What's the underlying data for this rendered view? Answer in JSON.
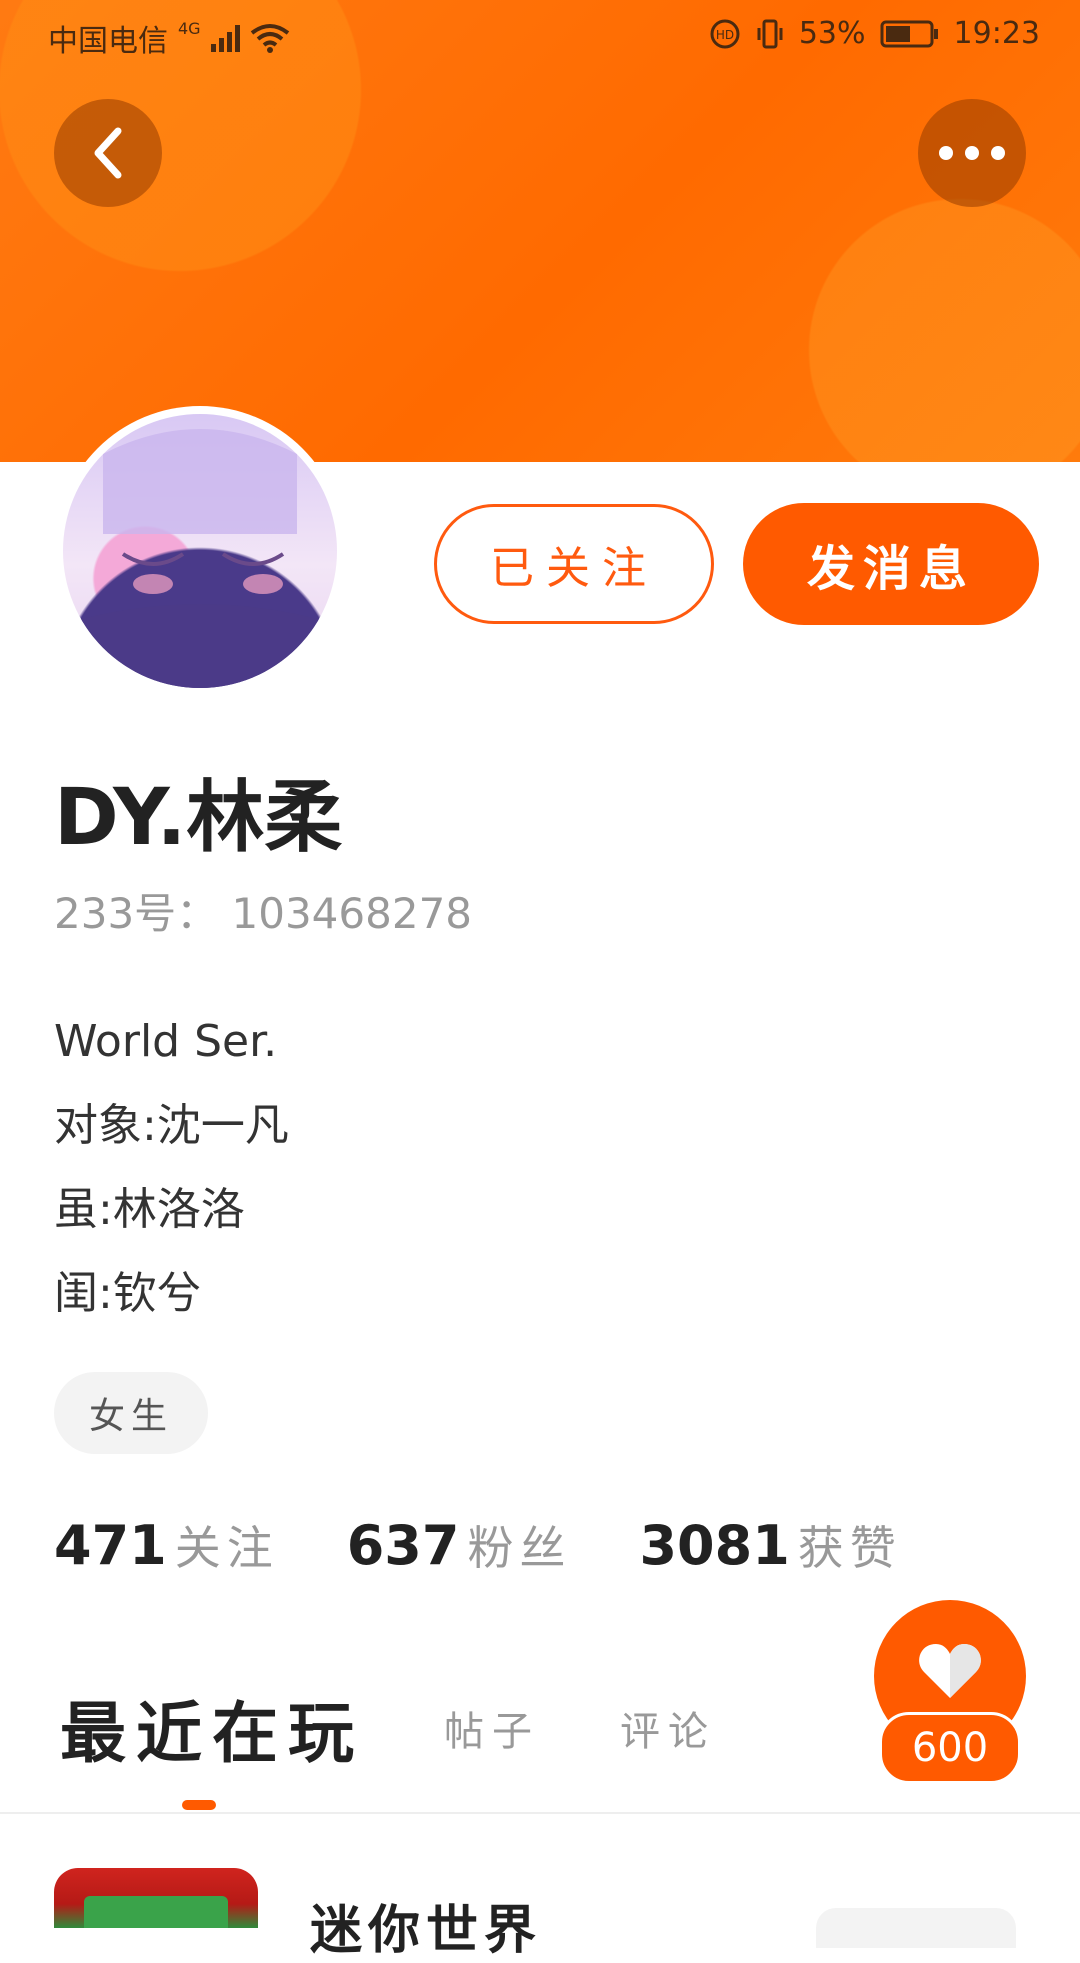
{
  "status_bar": {
    "carrier": "中国电信",
    "network": "4G",
    "battery_percent": "53%",
    "time": "19:23"
  },
  "header": {
    "back_icon": "chevron-left-icon",
    "more_icon": "more-horizontal-icon",
    "gradient_color": "#ff6a00"
  },
  "profile": {
    "avatar_icon": "user-avatar",
    "name": "DY.林柔",
    "uid": "233号： 103468278",
    "bio": [
      "World Ser.",
      "对象:沈一凡",
      "虽:林洛洛",
      "闺:钦兮"
    ],
    "tag": "女生"
  },
  "actions": {
    "following_label": "已关注",
    "message_label": "发消息"
  },
  "stats": [
    {
      "num": "471",
      "label": "关注"
    },
    {
      "num": "637",
      "label": "粉丝"
    },
    {
      "num": "3081",
      "label": "获赞"
    }
  ],
  "like": {
    "icon": "heart-icon",
    "count": "600"
  },
  "tabs": {
    "active": "最近在玩",
    "items": [
      "帖子",
      "评论"
    ]
  },
  "recent_game": {
    "title": "迷你世界"
  },
  "colors": {
    "accent": "#ff5a00",
    "header": "#ff6a00"
  }
}
